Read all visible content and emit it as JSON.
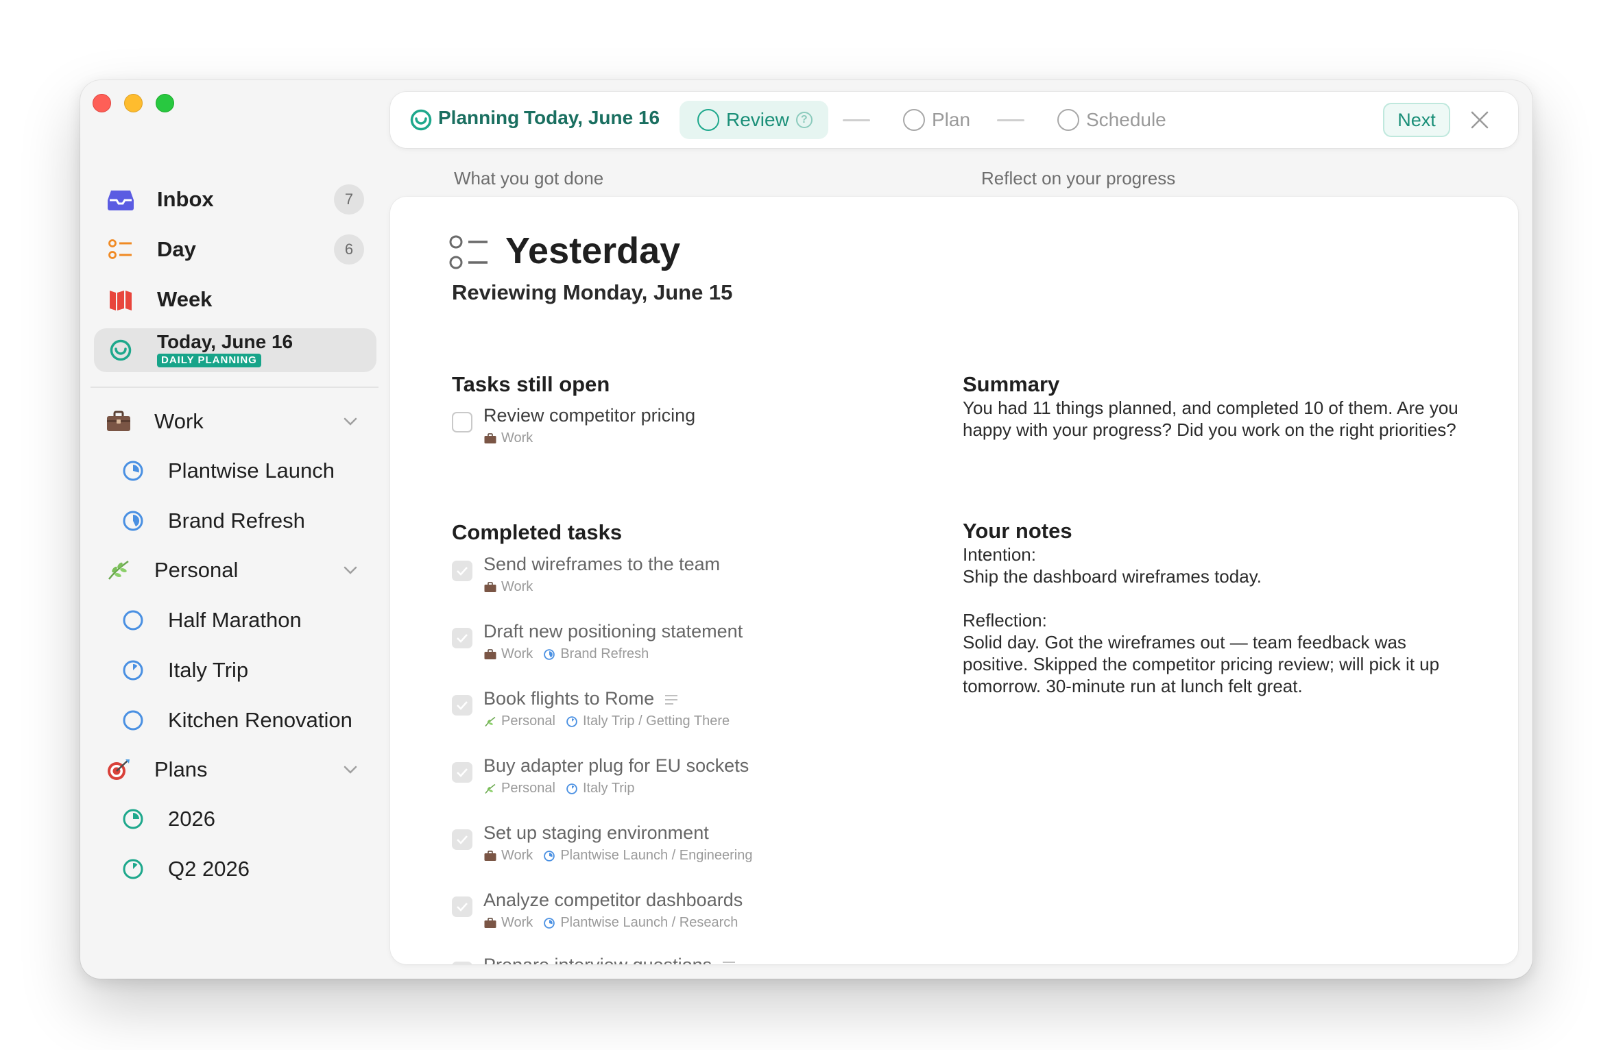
{
  "sidebar": {
    "inbox": {
      "label": "Inbox",
      "count": "7"
    },
    "day": {
      "label": "Day",
      "count": "6"
    },
    "week": {
      "label": "Week"
    },
    "today": {
      "label": "Today, June 16",
      "tag": "DAILY PLANNING"
    },
    "groups": [
      {
        "label": "Work",
        "icon": "briefcase-icon",
        "projects": [
          "Plantwise Launch",
          "Brand Refresh"
        ]
      },
      {
        "label": "Personal",
        "icon": "leaf-icon",
        "projects": [
          "Half Marathon",
          "Italy Trip",
          "Kitchen Renovation"
        ]
      },
      {
        "label": "Plans",
        "icon": "target-icon",
        "projects": [
          "2026",
          "Q2 2026"
        ]
      }
    ]
  },
  "topbar": {
    "title": "Planning",
    "date": "Today, June 16",
    "steps": [
      "Review",
      "Plan",
      "Schedule"
    ],
    "next_label": "Next"
  },
  "columns": {
    "left_header": "What you got done",
    "right_header": "Reflect on your progress"
  },
  "review": {
    "title": "Yesterday",
    "subtitle": "Reviewing Monday, June 15",
    "open_title": "Tasks still open",
    "open_tasks": [
      {
        "name": "Review competitor pricing",
        "area": "Work",
        "project": ""
      }
    ],
    "completed_title": "Completed tasks",
    "completed_tasks": [
      {
        "name": "Send wireframes to the team",
        "area": "Work",
        "project": ""
      },
      {
        "name": "Draft new positioning statement",
        "area": "Work",
        "project": "Brand Refresh"
      },
      {
        "name": "Book flights to Rome",
        "area": "Personal",
        "project": "Italy Trip / Getting There"
      },
      {
        "name": "Buy adapter plug for EU sockets",
        "area": "Personal",
        "project": "Italy Trip"
      },
      {
        "name": "Set up staging environment",
        "area": "Work",
        "project": "Plantwise Launch / Engineering"
      },
      {
        "name": "Analyze competitor dashboards",
        "area": "Work",
        "project": "Plantwise Launch / Research"
      },
      {
        "name": "Prepare interview questions",
        "area": "",
        "project": ""
      }
    ]
  },
  "reflect": {
    "summary_title": "Summary",
    "summary_text": "You had 11 things planned, and completed 10 of them. Are you happy with your progress? Did you work on the right priorities?",
    "notes_title": "Your notes",
    "notes_text": "Intention:\nShip the dashboard wireframes today.\n\nReflection:\nSolid day. Got the wireframes out — team feedback was positive. Skipped the competitor pricing review; will pick it up tomorrow. 30-minute run at lunch felt great."
  },
  "colors": {
    "accent": "#1ea88c",
    "inbox": "#5b5ce2",
    "day": "#f08a24",
    "week": "#e8453c",
    "project": "#4a90e2"
  }
}
